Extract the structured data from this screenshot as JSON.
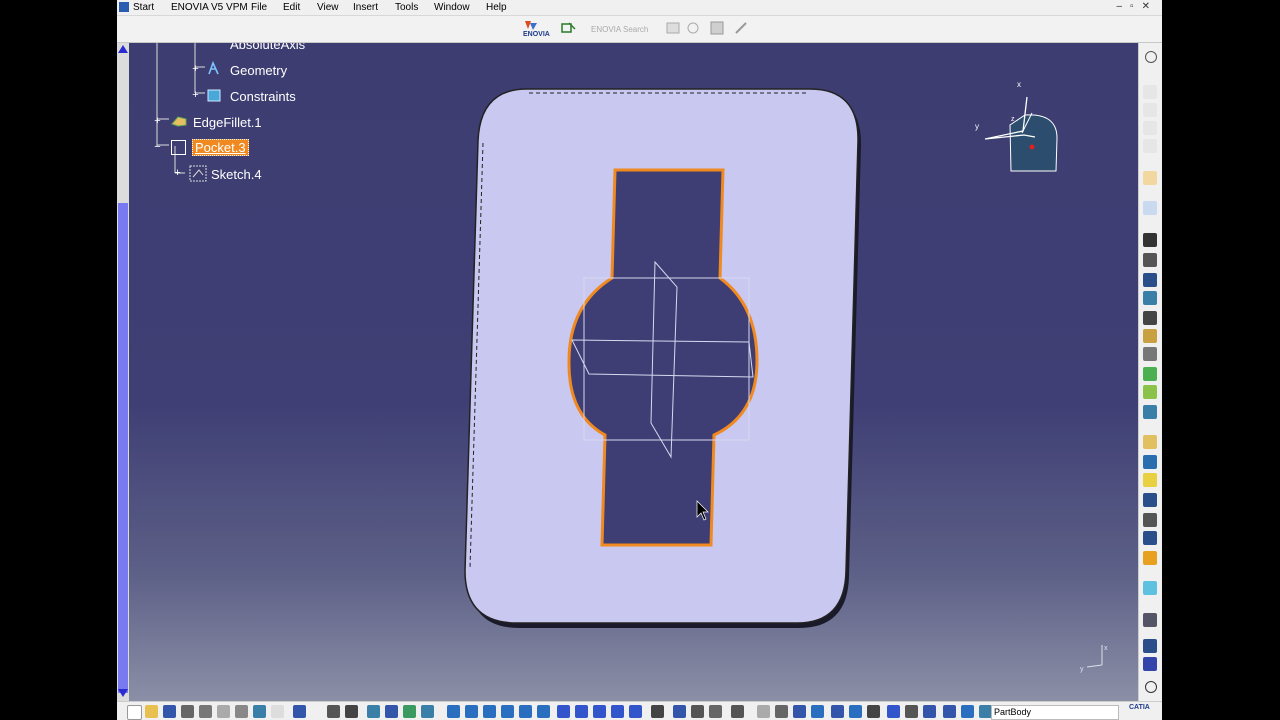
{
  "menu": {
    "start": "Start",
    "product": "ENOVIA V5 VPM",
    "file": "File",
    "edit": "Edit",
    "view": "View",
    "insert": "Insert",
    "tools": "Tools",
    "window": "Window",
    "help": "Help"
  },
  "toolbar": {
    "enovia_label": "ENOVIA",
    "search_label": "ENOVIA Search"
  },
  "tree": {
    "absolute_axis": "AbsoluteAxis",
    "geometry": "Geometry",
    "constraints": "Constraints",
    "edge_fillet": "EdgeFillet.1",
    "pocket": "Pocket.3",
    "sketch": "Sketch.4"
  },
  "compass": {
    "x_label": "x",
    "y_label": "y",
    "z_label": "z"
  },
  "axis_small": {
    "x_label": "x",
    "y_label": "y"
  },
  "bottom": {
    "current_body": "PartBody",
    "brand": "CATIA"
  },
  "colors": {
    "selection": "#f08a20",
    "part_face": "#c8c8f0",
    "background_top": "#3d3d72",
    "background_bottom": "#8b8fa6"
  }
}
